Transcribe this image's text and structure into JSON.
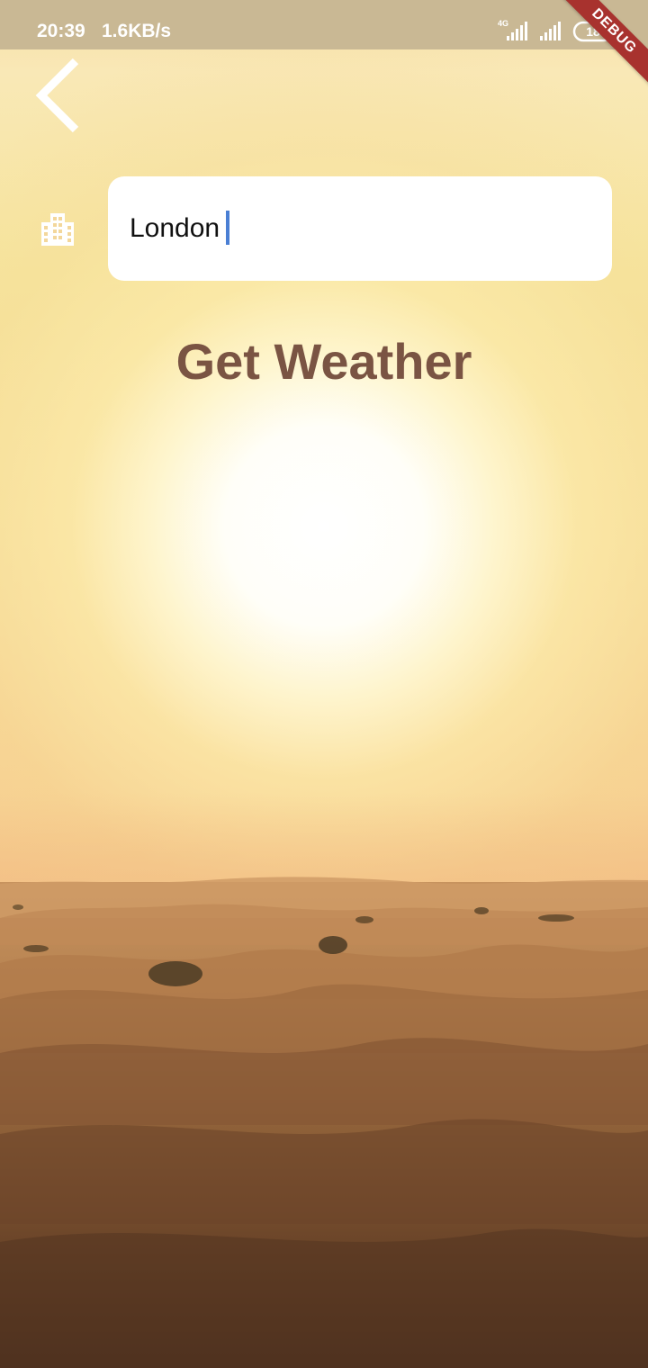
{
  "status_bar": {
    "time": "20:39",
    "network_speed": "1.6KB/s",
    "network_type": "4G",
    "battery_level": "18"
  },
  "debug_banner": {
    "label": "DEBUG"
  },
  "navigation": {
    "back_icon": "chevron-left-icon"
  },
  "search": {
    "icon": "city-icon",
    "value": "London"
  },
  "action": {
    "label": "Get Weather"
  },
  "colors": {
    "action_text": "#7a5443",
    "input_background": "#ffffff",
    "caret": "#4a7fd4",
    "status_bar": "#c9b894",
    "debug_ribbon": "#a8322e"
  }
}
